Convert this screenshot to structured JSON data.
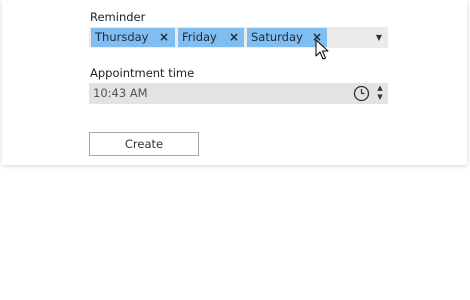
{
  "reminder": {
    "label": "Reminder",
    "selected_days": [
      "Thursday",
      "Friday",
      "Saturday"
    ],
    "remove_glyph": "×",
    "dropdown_glyph": "▼"
  },
  "appointment": {
    "label": "Appointment time",
    "value": "10:43 AM",
    "spin_up_glyph": "▲",
    "spin_down_glyph": "▼"
  },
  "actions": {
    "create_label": "Create"
  },
  "colors": {
    "tag_background": "#80bdf0",
    "field_background": "#ebebeb",
    "time_field_background": "#e3e3e3"
  },
  "icons": {
    "clock": "clock-icon",
    "cursor": "mouse-pointer-icon"
  }
}
